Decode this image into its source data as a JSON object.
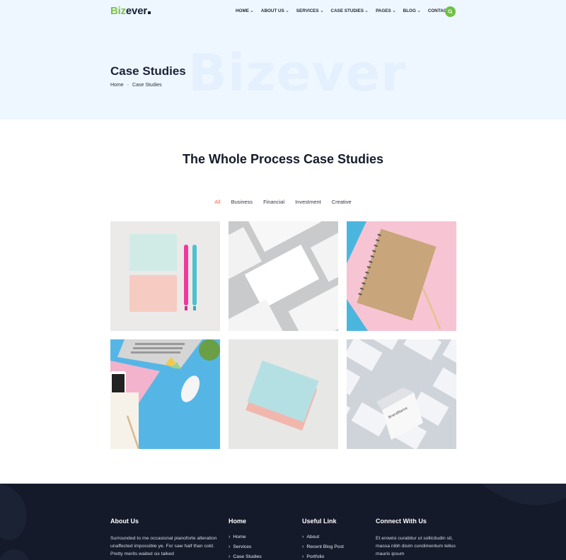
{
  "brand": {
    "part1": "Biz",
    "part2": "ever",
    "accent": "#7cc242"
  },
  "nav": [
    {
      "label": "HOME",
      "dropdown": true
    },
    {
      "label": "ABOUT US",
      "dropdown": true
    },
    {
      "label": "SERVICES",
      "dropdown": true
    },
    {
      "label": "CASE STUDIES",
      "dropdown": true
    },
    {
      "label": "PAGES",
      "dropdown": true
    },
    {
      "label": "BLOG",
      "dropdown": true
    },
    {
      "label": "CONTACT",
      "dropdown": false
    }
  ],
  "hero": {
    "watermark": "Bizever",
    "title": "Case Studies",
    "breadcrumb": [
      "Home",
      "Case Studies"
    ],
    "separator": "-"
  },
  "section": {
    "title": "The Whole Process Case Studies"
  },
  "filters": [
    {
      "label": "All",
      "active": true
    },
    {
      "label": "Business",
      "active": false
    },
    {
      "label": "Financial",
      "active": false
    },
    {
      "label": "Investment",
      "active": false
    },
    {
      "label": "Creative",
      "active": false
    }
  ],
  "gallery": [
    {
      "name": "sticky-notes-pens"
    },
    {
      "name": "business-cards-pattern"
    },
    {
      "name": "kraft-notebook"
    },
    {
      "name": "desk-workspace"
    },
    {
      "name": "notepad-stack"
    },
    {
      "name": "white-cards-mockup"
    }
  ],
  "footer": {
    "about": {
      "title": "About Us",
      "text": "Surrounded to me occasional pianoforte alteration unaffected impossible ye. For saw half than cold. Pretty merits waited six talked"
    },
    "home": {
      "title": "Home",
      "links": [
        "Home",
        "Services",
        "Case Studies"
      ]
    },
    "useful": {
      "title": "Useful Link",
      "links": [
        "About",
        "Recent Blog Post",
        "Portfolio"
      ]
    },
    "connect": {
      "title": "Connect With Us",
      "text": "Et erowisi curabitur ut sollicitudin sit, massa nibh disim condimentum tellus mauris ipsum"
    }
  }
}
